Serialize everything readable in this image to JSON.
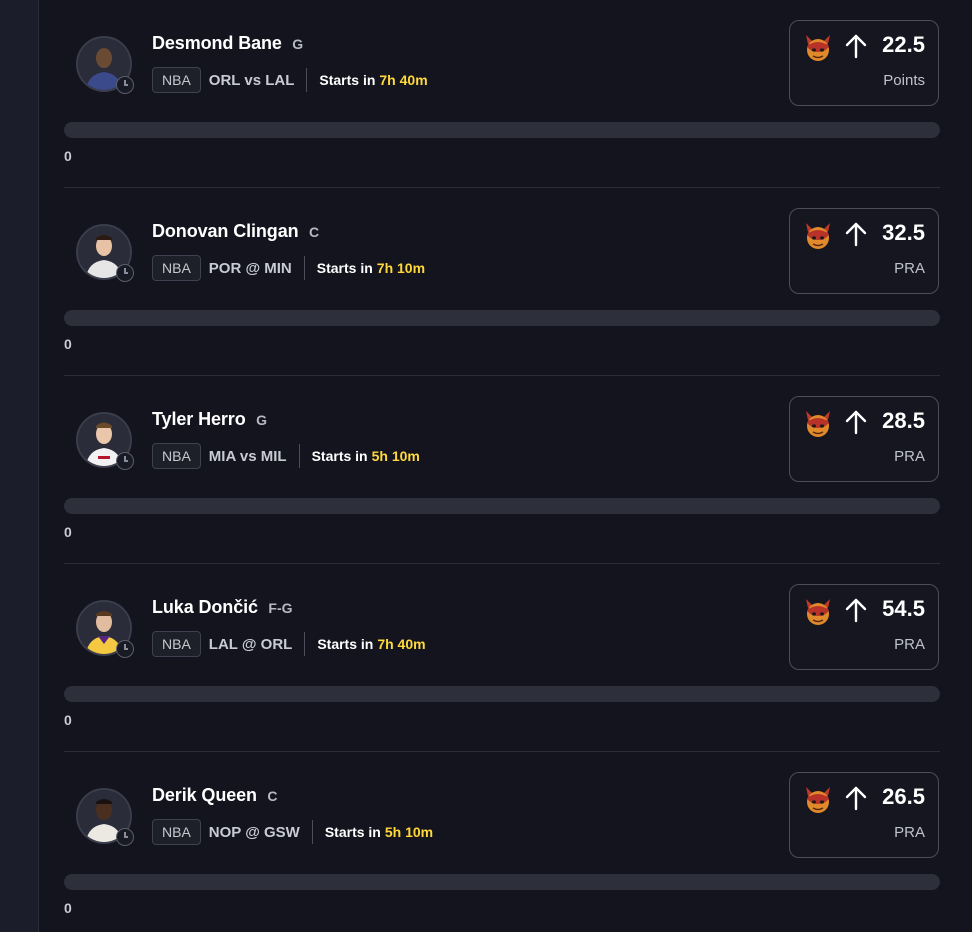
{
  "picks": [
    {
      "player": "Desmond Bane",
      "position": "G",
      "league": "NBA",
      "matchup": "ORL vs LAL",
      "starts_label": "Starts in",
      "starts_time": "7h 40m",
      "line": "22.5",
      "stat": "Points",
      "direction": "up-arrow-icon",
      "progress": 0,
      "progress_label": "0",
      "jersey_color": "#3b4a8a"
    },
    {
      "player": "Donovan Clingan",
      "position": "C",
      "league": "NBA",
      "matchup": "POR @ MIN",
      "starts_label": "Starts in",
      "starts_time": "7h 10m",
      "line": "32.5",
      "stat": "PRA",
      "direction": "up-arrow-icon",
      "progress": 0,
      "progress_label": "0",
      "jersey_color": "#e6e6e6"
    },
    {
      "player": "Tyler Herro",
      "position": "G",
      "league": "NBA",
      "matchup": "MIA vs MIL",
      "starts_label": "Starts in",
      "starts_time": "5h 10m",
      "line": "28.5",
      "stat": "PRA",
      "direction": "up-arrow-icon",
      "progress": 0,
      "progress_label": "0",
      "jersey_color": "#f2f2f2"
    },
    {
      "player": "Luka Dončić",
      "position": "F-G",
      "league": "NBA",
      "matchup": "LAL @ ORL",
      "starts_label": "Starts in",
      "starts_time": "7h 40m",
      "line": "54.5",
      "stat": "PRA",
      "direction": "up-arrow-icon",
      "progress": 0,
      "progress_label": "0",
      "jersey_color": "#f5c842"
    },
    {
      "player": "Derik Queen",
      "position": "C",
      "league": "NBA",
      "matchup": "NOP @ GSW",
      "starts_label": "Starts in",
      "starts_time": "5h 10m",
      "line": "26.5",
      "stat": "PRA",
      "direction": "up-arrow-icon",
      "progress": 0,
      "progress_label": "0",
      "jersey_color": "#ece9e2"
    }
  ],
  "colors": {
    "countdown": "#ffd93b",
    "progress_track": "#2d2f3b",
    "demon_primary": "#c0392b",
    "demon_face": "#f0a030"
  },
  "icons": {
    "pick_icon": "demon-icon",
    "status_icon": "clock-icon"
  }
}
